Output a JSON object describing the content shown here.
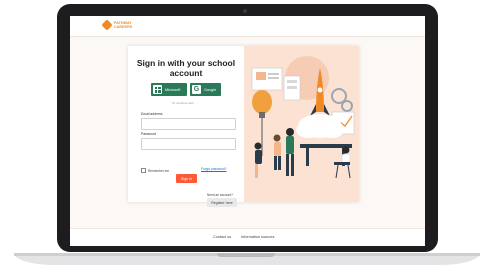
{
  "brand": {
    "logo_text": "PATHWAY\nCAREERS"
  },
  "login": {
    "title": "Sign in with your school account",
    "sso_microsoft": "Microsoft",
    "sso_google": "Google",
    "divider": "Or continue with",
    "email_label": "Email address",
    "email_value": "",
    "password_label": "Password",
    "password_value": "",
    "remember_label": "Remember me",
    "forgot_label": "Forgot password?",
    "signin_label": "Sign in",
    "need_account": "Need an account?",
    "register_label": "Register here"
  },
  "footer": {
    "contact": "Contact us",
    "info": "Information sources"
  },
  "colors": {
    "accent": "#ff5a36",
    "sso": "#2a7a5a",
    "illustration_bg": "#fbe2d2",
    "rocket": "#f08a24"
  },
  "icons": [
    "microsoft-icon",
    "google-icon",
    "rocket-illustration",
    "logo-icon"
  ]
}
